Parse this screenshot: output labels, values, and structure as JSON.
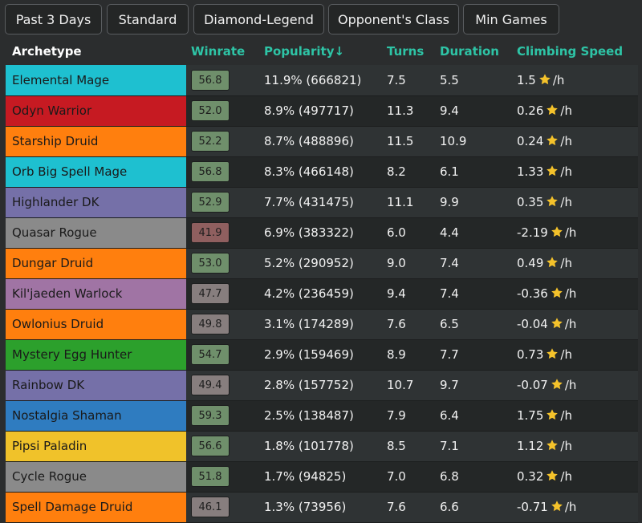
{
  "filters": [
    {
      "label": "Past 3 Days"
    },
    {
      "label": "Standard"
    },
    {
      "label": "Diamond-Legend"
    },
    {
      "label": "Opponent's Class"
    },
    {
      "label": "Min Games"
    }
  ],
  "headers": {
    "archetype": "Archetype",
    "winrate": "Winrate",
    "popularity": "Popularity↓",
    "turns": "Turns",
    "duration": "Duration",
    "climbing": "Climbing Speed"
  },
  "climb_unit": "/h",
  "star_icon": "star-icon",
  "colors": {
    "accent": "#2ec4a6",
    "winrate_high": "#6f8f6b",
    "winrate_low": "#8f5f5f",
    "winrate_mid": "#877e7e",
    "star": "#f4c22b"
  },
  "rows": [
    {
      "archetype": "Elemental Mage",
      "color": "#1ec0d0",
      "winrate": "56.8",
      "wr_color": "#6f8f6b",
      "popularity": "11.9% (666821)",
      "turns": "7.5",
      "duration": "5.5",
      "climbing": "1.5"
    },
    {
      "archetype": "Odyn Warrior",
      "color": "#c61a22",
      "winrate": "52.0",
      "wr_color": "#6f8f6b",
      "popularity": "8.9% (497717)",
      "turns": "11.3",
      "duration": "9.4",
      "climbing": "0.26"
    },
    {
      "archetype": "Starship Druid",
      "color": "#ff7f0e",
      "winrate": "52.2",
      "wr_color": "#6f8f6b",
      "popularity": "8.7% (488896)",
      "turns": "11.5",
      "duration": "10.9",
      "climbing": "0.24"
    },
    {
      "archetype": "Orb Big Spell Mage",
      "color": "#1ec0d0",
      "winrate": "56.8",
      "wr_color": "#6f8f6b",
      "popularity": "8.3% (466148)",
      "turns": "8.2",
      "duration": "6.1",
      "climbing": "1.33"
    },
    {
      "archetype": "Highlander DK",
      "color": "#7570a8",
      "winrate": "52.9",
      "wr_color": "#6f8f6b",
      "popularity": "7.7% (431475)",
      "turns": "11.1",
      "duration": "9.9",
      "climbing": "0.35"
    },
    {
      "archetype": "Quasar Rogue",
      "color": "#8a8a8a",
      "winrate": "41.9",
      "wr_color": "#8f5f5f",
      "popularity": "6.9% (383322)",
      "turns": "6.0",
      "duration": "4.4",
      "climbing": "-2.19"
    },
    {
      "archetype": "Dungar Druid",
      "color": "#ff7f0e",
      "winrate": "53.0",
      "wr_color": "#6f8f6b",
      "popularity": "5.2% (290952)",
      "turns": "9.0",
      "duration": "7.4",
      "climbing": "0.49"
    },
    {
      "archetype": "Kil'jaeden Warlock",
      "color": "#a074a4",
      "winrate": "47.7",
      "wr_color": "#877e7e",
      "popularity": "4.2% (236459)",
      "turns": "9.4",
      "duration": "7.4",
      "climbing": "-0.36"
    },
    {
      "archetype": "Owlonius Druid",
      "color": "#ff7f0e",
      "winrate": "49.8",
      "wr_color": "#877e7e",
      "popularity": "3.1% (174289)",
      "turns": "7.6",
      "duration": "6.5",
      "climbing": "-0.04"
    },
    {
      "archetype": "Mystery Egg Hunter",
      "color": "#2ca02c",
      "winrate": "54.7",
      "wr_color": "#6f8f6b",
      "popularity": "2.9% (159469)",
      "turns": "8.9",
      "duration": "7.7",
      "climbing": "0.73"
    },
    {
      "archetype": "Rainbow DK",
      "color": "#7570a8",
      "winrate": "49.4",
      "wr_color": "#877e7e",
      "popularity": "2.8% (157752)",
      "turns": "10.7",
      "duration": "9.7",
      "climbing": "-0.07"
    },
    {
      "archetype": "Nostalgia Shaman",
      "color": "#2f7cc0",
      "winrate": "59.3",
      "wr_color": "#6f8f6b",
      "popularity": "2.5% (138487)",
      "turns": "7.9",
      "duration": "6.4",
      "climbing": "1.75"
    },
    {
      "archetype": "Pipsi Paladin",
      "color": "#f0c22a",
      "winrate": "56.6",
      "wr_color": "#6f8f6b",
      "popularity": "1.8% (101778)",
      "turns": "8.5",
      "duration": "7.1",
      "climbing": "1.12"
    },
    {
      "archetype": "Cycle Rogue",
      "color": "#8a8a8a",
      "winrate": "51.8",
      "wr_color": "#6f8f6b",
      "popularity": "1.7% (94825)",
      "turns": "7.0",
      "duration": "6.8",
      "climbing": "0.32"
    },
    {
      "archetype": "Spell Damage Druid",
      "color": "#ff7f0e",
      "winrate": "46.1",
      "wr_color": "#877e7e",
      "popularity": "1.3% (73956)",
      "turns": "7.6",
      "duration": "6.6",
      "climbing": "-0.71"
    }
  ]
}
